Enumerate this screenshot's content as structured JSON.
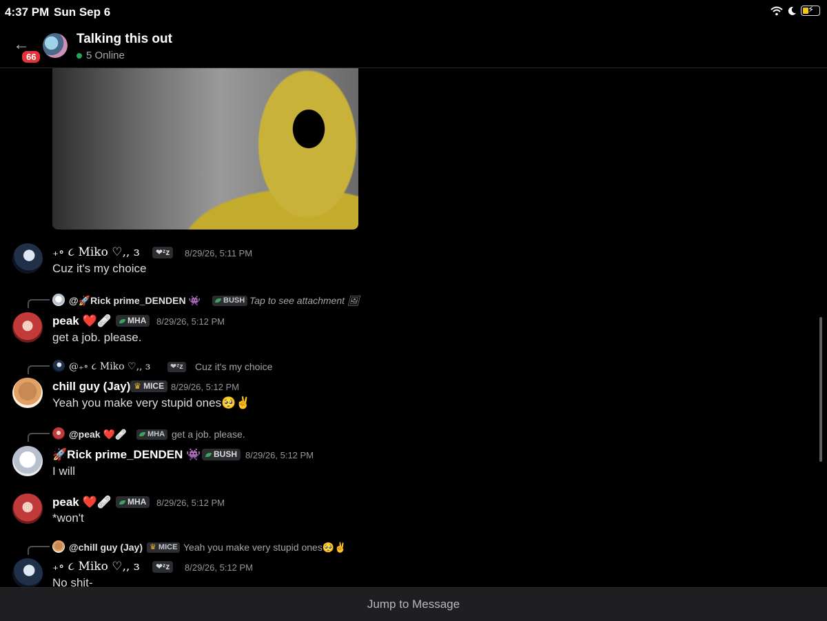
{
  "status_bar": {
    "time": "4:37 PM",
    "date": "Sun Sep 6",
    "icons": [
      "wifi-icon",
      "moon-icon",
      "battery-charging-icon"
    ]
  },
  "header": {
    "back_icon": "←",
    "unread_badge": "66",
    "channel_name": "Talking this out",
    "online_status": "5 Online"
  },
  "messages": [
    {
      "author": "₊∘ ૮ Miko ♡‚‚ ɜ",
      "tag": "❤ᶻz",
      "timestamp": "8/29/26, 5:11 PM",
      "text": "Cuz it's my choice"
    },
    {
      "reply_to": {
        "author": "@🚀Rick prime_DENDEN 👾",
        "tag": "BUSH",
        "text": "Tap to see attachment 🖼"
      },
      "author": "peak ❤️🩹",
      "tag": "MHA",
      "timestamp": "8/29/26, 5:12 PM",
      "text": "get a job. please."
    },
    {
      "reply_to": {
        "author": "@₊∘ ૮ Miko ♡‚‚ ɜ",
        "tag": "❤ᶻz",
        "text": "Cuz it's my choice"
      },
      "author": "chill guy (Jay)",
      "tag": "MICE",
      "timestamp": "8/29/26, 5:12 PM",
      "text": "Yeah you make very stupid ones🥺✌️"
    },
    {
      "reply_to": {
        "author": "@peak ❤️🩹",
        "tag": "MHA",
        "text": "get a job. please."
      },
      "author": "🚀Rick prime_DENDEN 👾",
      "tag": "BUSH",
      "timestamp": "8/29/26, 5:12 PM",
      "text": "I will"
    },
    {
      "author": "peak ❤️🩹",
      "tag": "MHA",
      "timestamp": "8/29/26, 5:12 PM",
      "text": "*won't"
    },
    {
      "reply_to": {
        "author": "@chill guy (Jay)",
        "tag": "MICE",
        "text": "Yeah you make very stupid ones🥺✌️"
      },
      "author": "₊∘ ૮ Miko ♡‚‚ ɜ",
      "tag": "❤ᶻz",
      "timestamp": "8/29/26, 5:12 PM",
      "text": "No shit-"
    }
  ],
  "jump_bar": {
    "label": "Jump to Message"
  }
}
